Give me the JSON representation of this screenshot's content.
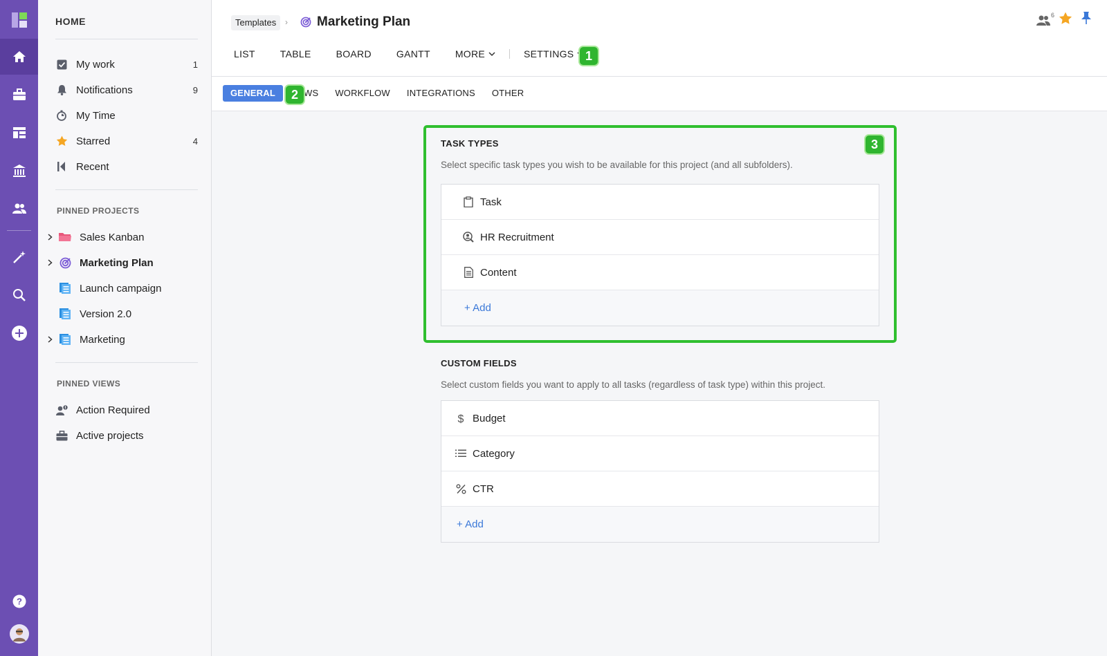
{
  "sidebar": {
    "home_label": "HOME",
    "items": [
      {
        "label": "My work",
        "count": "1",
        "icon": "checkbox-icon"
      },
      {
        "label": "Notifications",
        "count": "9",
        "icon": "bell-icon"
      },
      {
        "label": "My Time",
        "count": "",
        "icon": "timer-icon"
      },
      {
        "label": "Starred",
        "count": "4",
        "icon": "star-icon"
      },
      {
        "label": "Recent",
        "count": "",
        "icon": "recent-icon"
      }
    ],
    "pinned_projects_title": "PINNED PROJECTS",
    "projects": [
      {
        "label": "Sales Kanban",
        "icon": "folder-icon"
      },
      {
        "label": "Marketing Plan",
        "icon": "target-icon"
      },
      {
        "label": "Launch campaign",
        "icon": "list-icon"
      },
      {
        "label": "Version 2.0",
        "icon": "list-icon"
      },
      {
        "label": "Marketing",
        "icon": "list-icon"
      }
    ],
    "pinned_views_title": "PINNED VIEWS",
    "views": [
      {
        "label": "Action Required",
        "icon": "user-alert-icon"
      },
      {
        "label": "Active projects",
        "icon": "briefcase-icon"
      }
    ]
  },
  "header": {
    "breadcrumb": "Templates",
    "title": "Marketing Plan",
    "members_count": "6",
    "tabs": [
      "LIST",
      "TABLE",
      "BOARD",
      "GANTT",
      "MORE",
      "SETTINGS"
    ]
  },
  "subnav": {
    "tabs": [
      "GENERAL",
      "WS",
      "WORKFLOW",
      "INTEGRATIONS",
      "OTHER"
    ]
  },
  "badges": [
    "1",
    "2",
    "3"
  ],
  "task_types": {
    "title": "TASK TYPES",
    "description": "Select specific task types you wish to be available for this project (and all subfolders).",
    "items": [
      {
        "label": "Task",
        "icon": "clipboard-icon"
      },
      {
        "label": "HR Recruitment",
        "icon": "recruit-icon"
      },
      {
        "label": "Content",
        "icon": "document-icon"
      }
    ],
    "add_label": "+ Add"
  },
  "custom_fields": {
    "title": "CUSTOM FIELDS",
    "description": "Select custom fields you want to apply to all tasks (regardless of task type) within this project.",
    "items": [
      {
        "label": "Budget",
        "icon": "dollar-icon"
      },
      {
        "label": "Category",
        "icon": "list-lines-icon"
      },
      {
        "label": "CTR",
        "icon": "percent-icon"
      }
    ],
    "add_label": "+ Add"
  },
  "colors": {
    "rail": "#6c4fb3",
    "accent_blue": "#4a7fe0",
    "callout_green": "#2fbf2f",
    "star": "#f5a623"
  }
}
